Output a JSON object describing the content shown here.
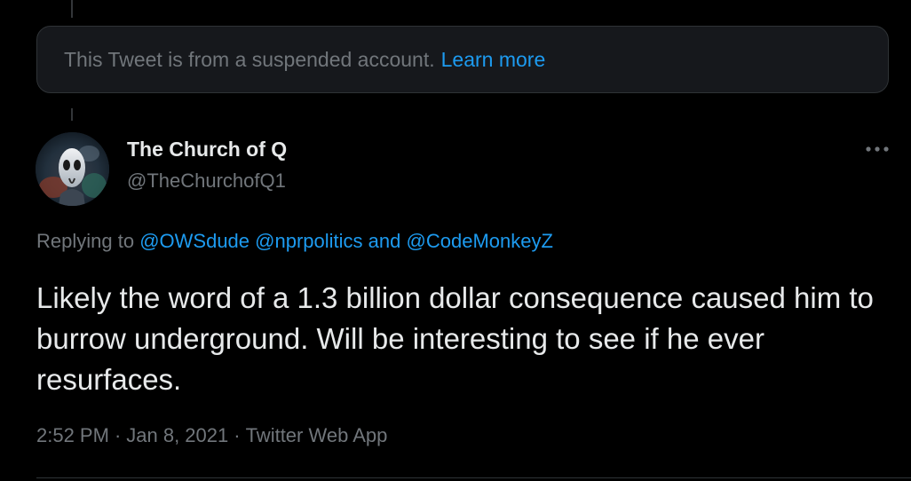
{
  "colors": {
    "background": "#000000",
    "text_primary": "#e7e9ea",
    "text_secondary": "#71767b",
    "link": "#1d9bf0",
    "box_background": "#16181c",
    "border": "#2f3336"
  },
  "suspended_notice": {
    "text": "This Tweet is from a suspended account.",
    "link_label": "Learn more"
  },
  "tweet": {
    "avatar_icon": "profile-avatar",
    "display_name": "The Church of Q",
    "handle": "@TheChurchofQ1",
    "more_icon": "more-horizontal-icon",
    "replying_to": {
      "prefix": "Replying to",
      "mentions": [
        "@OWSdude",
        "@nprpolitics"
      ],
      "conjunction": "and",
      "last_mention": "@CodeMonkeyZ"
    },
    "text": "Likely the word of a 1.3 billion dollar consequence caused him to burrow underground. Will be interesting to see if he ever resurfaces.",
    "time": "2:52 PM",
    "date": "Jan 8, 2021",
    "source": "Twitter Web App",
    "separator": "·"
  }
}
